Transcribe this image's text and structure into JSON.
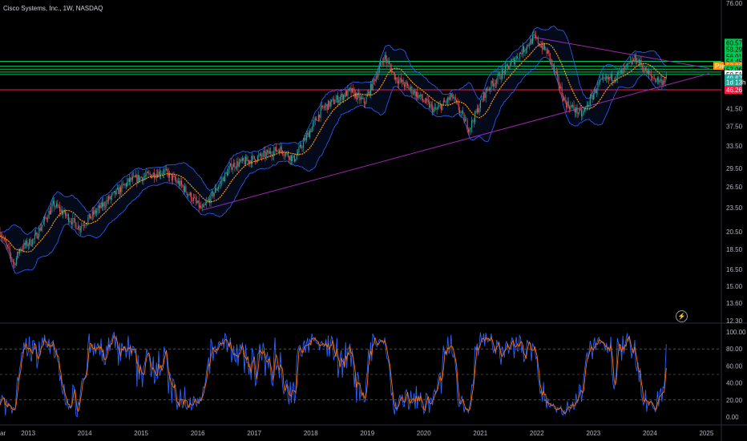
{
  "header": {
    "title": "Cisco Systems, Inc., 1W, NASDAQ"
  },
  "icons": {
    "replay": "lightning-icon"
  },
  "colors": {
    "background": "#000000",
    "bull": "#26a69a",
    "bear": "#ef5350",
    "ma": "#ff9800",
    "bands": "#2962ff",
    "trendline": "#9c27b0",
    "level_green": "#00c853",
    "level_red": "#ff1744",
    "stoch_k": "#2962ff",
    "stoch_d": "#ff6d00"
  },
  "chart_data": [
    {
      "type": "candlestick",
      "title": "Cisco Systems, Inc., 1W, NASDAQ",
      "y_scale": "log",
      "ylim": [
        12.3,
        76.0
      ],
      "xlim": [
        2012.5,
        2025.05
      ],
      "x_ticks": [
        "ar",
        "2013",
        "2014",
        "2015",
        "2016",
        "2017",
        "2018",
        "2019",
        "2020",
        "2021",
        "2022",
        "2023",
        "2024",
        "2025"
      ],
      "y_ticks": [
        "76.00",
        "41.50",
        "37.50",
        "33.50",
        "29.50",
        "26.50",
        "23.50",
        "20.50",
        "18.50",
        "16.50",
        "15.00",
        "13.60",
        "12.30"
      ],
      "horizontal_levels": [
        {
          "value": 54.45,
          "color": "green"
        },
        {
          "value": 53.0,
          "color": "green"
        },
        {
          "value": 52.06,
          "color": "green"
        },
        {
          "value": 51.2,
          "color": "green"
        },
        {
          "value": 50.51,
          "color": "green"
        },
        {
          "value": 46.26,
          "color": "red"
        }
      ],
      "price_tags": [
        {
          "label": "60.57",
          "value": 60.57,
          "bg": "#00c853",
          "fg": "#000000"
        },
        {
          "label": "58.29",
          "value": 58.29,
          "bg": "#00c853",
          "fg": "#000000"
        },
        {
          "label": "56.01",
          "value": 56.01,
          "bg": "#00c853",
          "fg": "#000000"
        },
        {
          "label": "54.45",
          "value": 54.45,
          "bg": "#00c853",
          "fg": "#000000"
        },
        {
          "label": "Pre",
          "value": 53.06,
          "bg": "#ff9800",
          "fg": "#ffffff",
          "prefix": true
        },
        {
          "label": "53.06",
          "value": 53.06,
          "bg": "#f57c00",
          "fg": "#ffffff"
        },
        {
          "label": "52.06",
          "value": 52.06,
          "bg": "#00c853",
          "fg": "#000000"
        },
        {
          "label": "50.51",
          "value": 50.51,
          "bg": "#ffffff",
          "fg": "#000000"
        },
        {
          "label": "49.67",
          "value": 49.4,
          "bg": "#26a69a",
          "fg": "#ffffff"
        },
        {
          "label": "1d 13h",
          "value": 48.3,
          "bg": "#26a69a",
          "fg": "#ffffff"
        },
        {
          "label": "46.26",
          "value": 46.26,
          "bg": "#ff1744",
          "fg": "#ffffff"
        }
      ],
      "anchors": [
        [
          2012.5,
          20.5
        ],
        [
          2012.75,
          17.0
        ],
        [
          2012.85,
          18.6
        ],
        [
          2013.1,
          19.6
        ],
        [
          2013.45,
          24.0
        ],
        [
          2013.9,
          21.0
        ],
        [
          2014.4,
          24.5
        ],
        [
          2014.8,
          27.5
        ],
        [
          2015.4,
          29.0
        ],
        [
          2015.7,
          26.8
        ],
        [
          2016.08,
          23.2
        ],
        [
          2016.6,
          30.0
        ],
        [
          2017.05,
          31.3
        ],
        [
          2017.45,
          33.0
        ],
        [
          2017.7,
          31.0
        ],
        [
          2018.2,
          41.5
        ],
        [
          2018.7,
          46.0
        ],
        [
          2018.95,
          43.0
        ],
        [
          2019.3,
          56.0
        ],
        [
          2019.5,
          49.5
        ],
        [
          2019.8,
          46.0
        ],
        [
          2020.2,
          41.0
        ],
        [
          2020.5,
          44.5
        ],
        [
          2020.8,
          37.0
        ],
        [
          2021.1,
          46.0
        ],
        [
          2021.5,
          53.0
        ],
        [
          2021.95,
          62.5
        ],
        [
          2022.2,
          57.0
        ],
        [
          2022.5,
          43.0
        ],
        [
          2022.8,
          40.0
        ],
        [
          2023.1,
          48.0
        ],
        [
          2023.5,
          51.0
        ],
        [
          2023.75,
          55.5
        ],
        [
          2024.0,
          50.0
        ],
        [
          2024.2,
          48.5
        ],
        [
          2024.3,
          49.67
        ]
      ],
      "trendlines": [
        {
          "from": [
            2016.08,
            23.2
          ],
          "to": [
            2025.05,
            50.8
          ]
        },
        {
          "from": [
            2021.95,
            62.5
          ],
          "to": [
            2025.05,
            52.3
          ]
        }
      ]
    },
    {
      "type": "line",
      "title": "",
      "ylim": [
        0,
        100
      ],
      "y_ticks": [
        "100.00",
        "80.00",
        "60.00",
        "40.00",
        "20.00",
        "0.00"
      ],
      "bands": [
        80,
        50,
        20
      ],
      "series": [
        {
          "color": "blue"
        },
        {
          "color": "orange"
        }
      ]
    }
  ]
}
